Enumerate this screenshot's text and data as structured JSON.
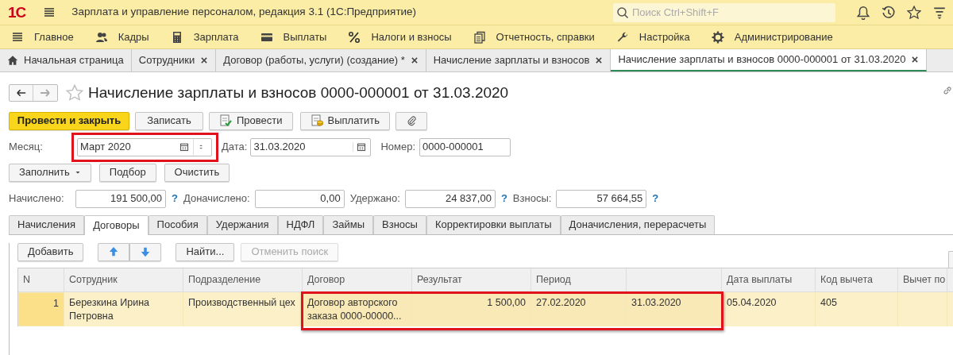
{
  "app": {
    "logo": "1С",
    "title": "Зарплата и управление персоналом, редакция 3.1  (1С:Предприятие)",
    "search": {
      "placeholder": "Поиск Ctrl+Shift+F"
    }
  },
  "sections": [
    {
      "label": "Главное"
    },
    {
      "label": "Кадры"
    },
    {
      "label": "Зарплата"
    },
    {
      "label": "Выплаты"
    },
    {
      "label": "Налоги и взносы"
    },
    {
      "label": "Отчетность, справки"
    },
    {
      "label": "Настройка"
    },
    {
      "label": "Администрирование"
    }
  ],
  "open_tabs": [
    {
      "label": "Начальная страница",
      "kind": "home",
      "selected": false
    },
    {
      "label": "Сотрудники",
      "kind": "closable",
      "selected": false
    },
    {
      "label": "Договор (работы, услуги) (создание) *",
      "kind": "closable",
      "selected": false
    },
    {
      "label": "Начисление зарплаты и взносов",
      "kind": "closable",
      "selected": false
    },
    {
      "label": "Начисление зарплаты и взносов 0000-000001 от 31.03.2020",
      "kind": "closable",
      "selected": true
    }
  ],
  "document": {
    "title": "Начисление зарплаты и взносов 0000-000001 от 31.03.2020",
    "buttons": [
      {
        "label": "Провести и закрыть",
        "kind": "primary"
      },
      {
        "label": "Записать",
        "kind": "plain"
      },
      {
        "label": "Провести",
        "kind": "post"
      },
      {
        "label": "Выплатить",
        "kind": "pay"
      },
      {
        "kind": "attach"
      }
    ],
    "month": {
      "label": "Месяц:",
      "value": "Март 2020",
      "highlighted": true
    },
    "date": {
      "label": "Дата:",
      "value": "31.03.2020"
    },
    "number": {
      "label": "Номер:",
      "value": "0000-000001"
    },
    "fill_buttons": [
      {
        "label": "Заполнить",
        "dropdown": true
      },
      {
        "label": "Подбор",
        "dropdown": false
      },
      {
        "label": "Очистить",
        "dropdown": false
      }
    ],
    "totals": [
      {
        "label": "Начислено:",
        "value": "191 500,00",
        "help": "?"
      },
      {
        "label": "Доначислено:",
        "value": "0,00"
      },
      {
        "label": "Удержано:",
        "value": "24 837,00",
        "help": "?"
      },
      {
        "label": "Взносы:",
        "value": "57 664,55",
        "help": "?"
      }
    ],
    "tabs": [
      {
        "label": "Начисления",
        "selected": false
      },
      {
        "label": "Договоры",
        "selected": true
      },
      {
        "label": "Пособия",
        "selected": false
      },
      {
        "label": "Удержания",
        "selected": false
      },
      {
        "label": "НДФЛ",
        "selected": false
      },
      {
        "label": "Займы",
        "selected": false
      },
      {
        "label": "Взносы",
        "selected": false
      },
      {
        "label": "Корректировки выплаты",
        "selected": false
      },
      {
        "label": "Доначисления, перерасчеты",
        "selected": false
      }
    ],
    "toolbar": [
      {
        "label": "Добавить",
        "kind": "button",
        "disabled": false
      },
      {
        "kind": "up",
        "disabled": false
      },
      {
        "kind": "down",
        "disabled": false
      },
      {
        "label": "Найти...",
        "kind": "button",
        "disabled": false
      },
      {
        "label": "Отменить поиск",
        "kind": "button",
        "disabled": true
      }
    ],
    "table": {
      "columns": [
        "N",
        "Сотрудник",
        "Подразделение",
        "Договор",
        "Результат",
        "Период",
        "",
        "Дата выплаты",
        "Код вычета",
        "Вычет по"
      ],
      "rows": [
        {
          "selected": true,
          "cells": [
            {
              "text": "1",
              "highlighted": false
            },
            {
              "text": "Березкина Ирина Петровна",
              "highlighted": false
            },
            {
              "text": "Производственный цех",
              "highlighted": false
            },
            {
              "text": "Договор авторского заказа 0000-00000...",
              "highlighted": true
            },
            {
              "text": "1 500,00",
              "highlighted": true
            },
            {
              "text": "27.02.2020",
              "highlighted": true
            },
            {
              "text": "31.03.2020",
              "highlighted": true
            },
            {
              "text": "05.04.2020",
              "highlighted": false
            },
            {
              "text": "405",
              "highlighted": false
            },
            {
              "text": "",
              "highlighted": false
            }
          ]
        }
      ]
    }
  }
}
